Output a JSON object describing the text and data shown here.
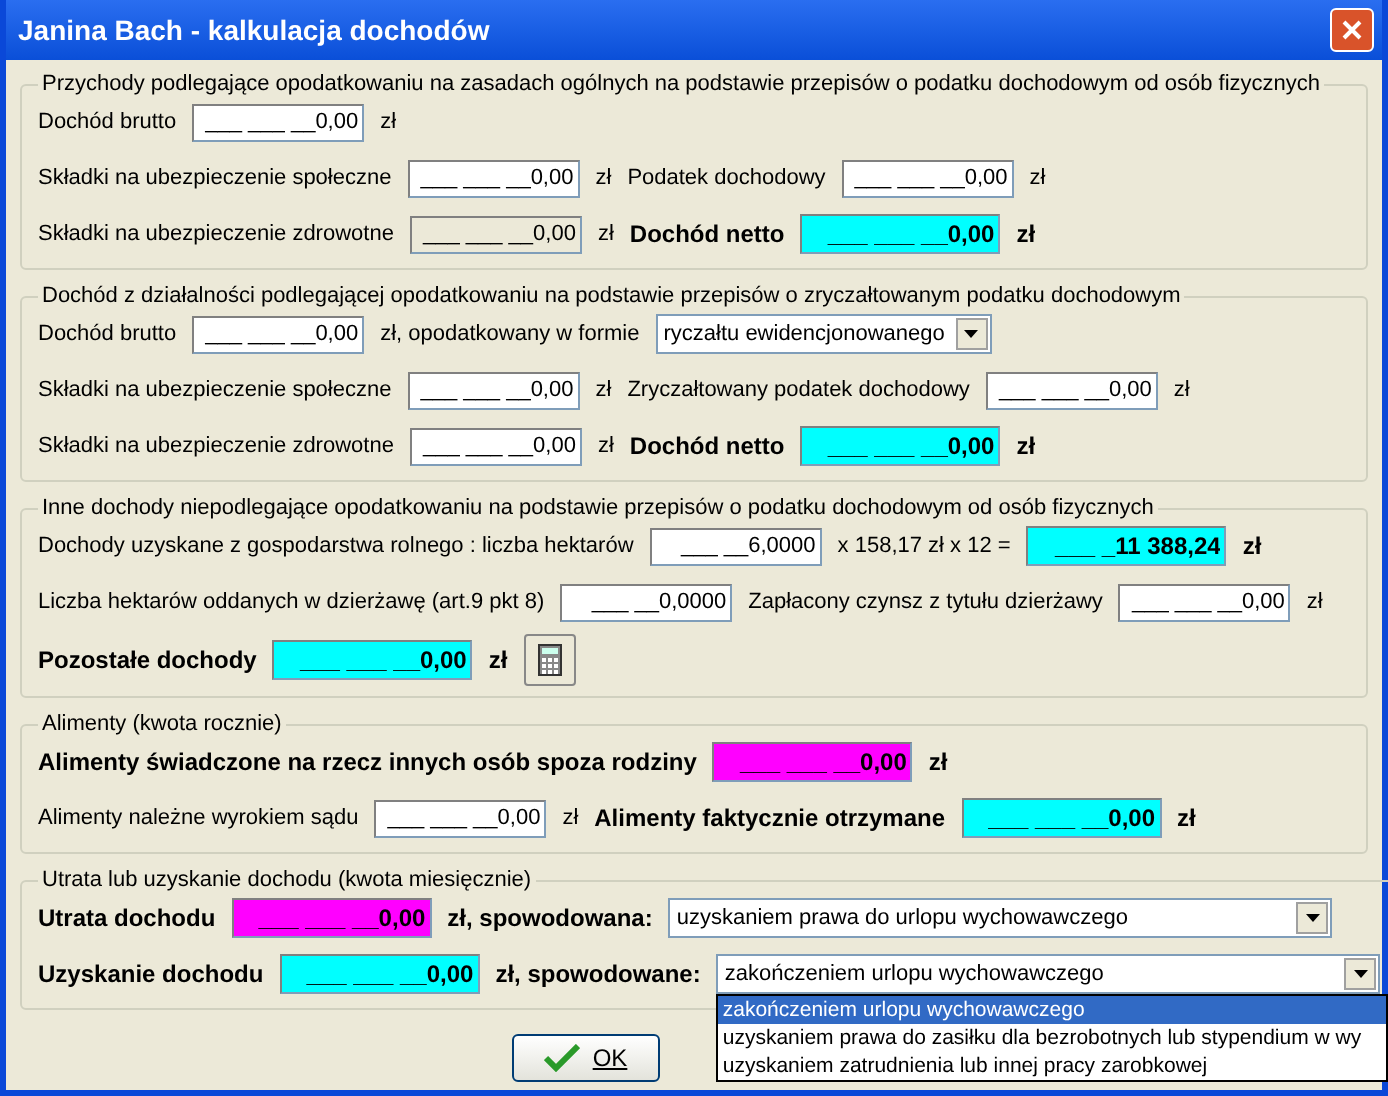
{
  "window": {
    "title": "Janina Bach - kalkulacja dochodów"
  },
  "sections": [
    {
      "title": "Przychody podlegające opodatkowaniu na zasadach ogólnych na podstawie przepisów o podatku dochodowym od osób fizycznych",
      "rows": [
        {
          "items": [
            {
              "kind": "label",
              "text": "Dochód brutto"
            },
            {
              "kind": "field",
              "color": "#ffffff",
              "value": "___ ___ __0,00"
            },
            {
              "kind": "label",
              "text": "zł"
            }
          ]
        },
        {
          "items": [
            {
              "kind": "label",
              "text": "Składki na ubezpieczenie społeczne"
            },
            {
              "kind": "field",
              "color": "#ffffff",
              "value": "___ ___ __0,00"
            },
            {
              "kind": "label",
              "text": "zł"
            },
            {
              "kind": "label",
              "text": "Podatek dochodowy"
            },
            {
              "kind": "field",
              "color": "#ffffff",
              "value": "___ ___ __0,00"
            },
            {
              "kind": "label",
              "text": "zł"
            }
          ]
        },
        {
          "items": [
            {
              "kind": "label",
              "text": "Składki na ubezpieczenie zdrowotne"
            },
            {
              "kind": "field",
              "color": "#ece9d8",
              "value": "___ ___ __0,00"
            },
            {
              "kind": "label",
              "text": "zł"
            },
            {
              "kind": "label",
              "bold": true,
              "text": "Dochód netto"
            },
            {
              "kind": "field",
              "color": "#00ffff",
              "bold": true,
              "value": "___ ___ __0,00"
            },
            {
              "kind": "label",
              "bold": true,
              "text": "zł"
            }
          ]
        }
      ]
    },
    {
      "title": "Dochód z działalności podlegającej opodatkowaniu na podstawie przepisów o zryczałtowanym podatku dochodowym",
      "rows": [
        {
          "items": [
            {
              "kind": "label",
              "text": "Dochód brutto"
            },
            {
              "kind": "field",
              "color": "#ffffff",
              "value": "___ ___ __0,00"
            },
            {
              "kind": "label",
              "text": "zł, opodatkowany w formie"
            },
            {
              "kind": "select",
              "value": "ryczałtu ewidencjonowanego",
              "wide": false
            }
          ]
        },
        {
          "items": [
            {
              "kind": "label",
              "text": "Składki na ubezpieczenie społeczne"
            },
            {
              "kind": "field",
              "color": "#ffffff",
              "value": "___ ___ __0,00"
            },
            {
              "kind": "label",
              "text": "zł"
            },
            {
              "kind": "label",
              "text": "Zryczałtowany podatek dochodowy"
            },
            {
              "kind": "field",
              "color": "#ffffff",
              "value": "___ ___ __0,00"
            },
            {
              "kind": "label",
              "text": "zł"
            }
          ]
        },
        {
          "items": [
            {
              "kind": "label",
              "text": "Składki na ubezpieczenie zdrowotne"
            },
            {
              "kind": "field",
              "color": "#ffffff",
              "value": "___ ___ __0,00"
            },
            {
              "kind": "label",
              "text": "zł"
            },
            {
              "kind": "label",
              "bold": true,
              "text": "Dochód netto"
            },
            {
              "kind": "field",
              "color": "#00ffff",
              "bold": true,
              "value": "___ ___ __0,00"
            },
            {
              "kind": "label",
              "bold": true,
              "text": "zł"
            }
          ]
        }
      ]
    },
    {
      "title": "Inne dochody niepodlegające opodatkowaniu na podstawie przepisów o podatku dochodowym od osób fizycznych",
      "rows": [
        {
          "items": [
            {
              "kind": "label",
              "text": "Dochody uzyskane z gospodarstwa rolnego : liczba hektarów"
            },
            {
              "kind": "field",
              "color": "#ffffff",
              "value": "___ __6,0000"
            },
            {
              "kind": "label",
              "text": "x 158,17 zł x 12 ="
            },
            {
              "kind": "field",
              "color": "#00ffff",
              "bold": true,
              "value": "___ _11 388,24"
            },
            {
              "kind": "label",
              "bold": true,
              "text": "zł"
            }
          ]
        },
        {
          "items": [
            {
              "kind": "label",
              "text": "Liczba hektarów oddanych w dzierżawę (art.9 pkt 8)"
            },
            {
              "kind": "field",
              "color": "#ffffff",
              "value": "___ __0,0000"
            },
            {
              "kind": "label",
              "text": "Zapłacony czynsz z tytułu dzierżawy"
            },
            {
              "kind": "field",
              "color": "#ffffff",
              "value": "___ ___ __0,00"
            },
            {
              "kind": "label",
              "text": "zł"
            }
          ]
        },
        {
          "items": [
            {
              "kind": "label",
              "bold": true,
              "text": "Pozostałe dochody"
            },
            {
              "kind": "field",
              "color": "#00ffff",
              "bold": true,
              "value": "___ ___ __0,00"
            },
            {
              "kind": "label",
              "bold": true,
              "text": "zł"
            },
            {
              "kind": "calc"
            }
          ]
        }
      ]
    },
    {
      "title": "Alimenty (kwota rocznie)",
      "rows": [
        {
          "items": [
            {
              "kind": "label",
              "bold": true,
              "text": "Alimenty świadczone na rzecz innych osób spoza rodziny"
            },
            {
              "kind": "field",
              "color": "#ff00ff",
              "bold": true,
              "value": "___ ___ __0,00"
            },
            {
              "kind": "label",
              "bold": true,
              "text": "zł"
            }
          ]
        },
        {
          "items": [
            {
              "kind": "label",
              "text": "Alimenty należne wyrokiem sądu"
            },
            {
              "kind": "field",
              "color": "#ffffff",
              "value": "___ ___ __0,00"
            },
            {
              "kind": "label",
              "text": "zł"
            },
            {
              "kind": "label",
              "bold": true,
              "text": "Alimenty faktycznie otrzymane"
            },
            {
              "kind": "field",
              "color": "#00ffff",
              "bold": true,
              "value": "___ ___ __0,00"
            },
            {
              "kind": "label",
              "bold": true,
              "text": "zł"
            }
          ]
        }
      ]
    },
    {
      "title": "Utrata lub uzyskanie dochodu (kwota miesięcznie)",
      "rows": [
        {
          "items": [
            {
              "kind": "label",
              "bold": true,
              "text": "Utrata dochodu"
            },
            {
              "kind": "field",
              "color": "#ff00ff",
              "bold": true,
              "value": "___ ___ __0,00"
            },
            {
              "kind": "label",
              "bold": true,
              "text": "zł, spowodowana:"
            },
            {
              "kind": "select",
              "wide": true,
              "value": "uzyskaniem prawa do urlopu wychowawczego"
            }
          ]
        },
        {
          "items": [
            {
              "kind": "label",
              "bold": true,
              "text": "Uzyskanie dochodu"
            },
            {
              "kind": "field",
              "color": "#00ffff",
              "bold": true,
              "value": "___ ___ __0,00"
            },
            {
              "kind": "label",
              "bold": true,
              "text": "zł, spowodowane:"
            },
            {
              "kind": "select",
              "wide": true,
              "value": "zakończeniem urlopu wychowawczego",
              "open": true,
              "options": [
                {
                  "label": "zakończeniem urlopu wychowawczego",
                  "selected": true
                },
                {
                  "label": "uzyskaniem prawa do zasiłku dla bezrobotnych lub stypendium w wy",
                  "selected": false
                },
                {
                  "label": "uzyskaniem zatrudnienia lub innej pracy zarobkowej",
                  "selected": false
                }
              ]
            }
          ]
        }
      ]
    }
  ],
  "buttons": [
    {
      "label": "OK",
      "kind": "ok"
    }
  ]
}
